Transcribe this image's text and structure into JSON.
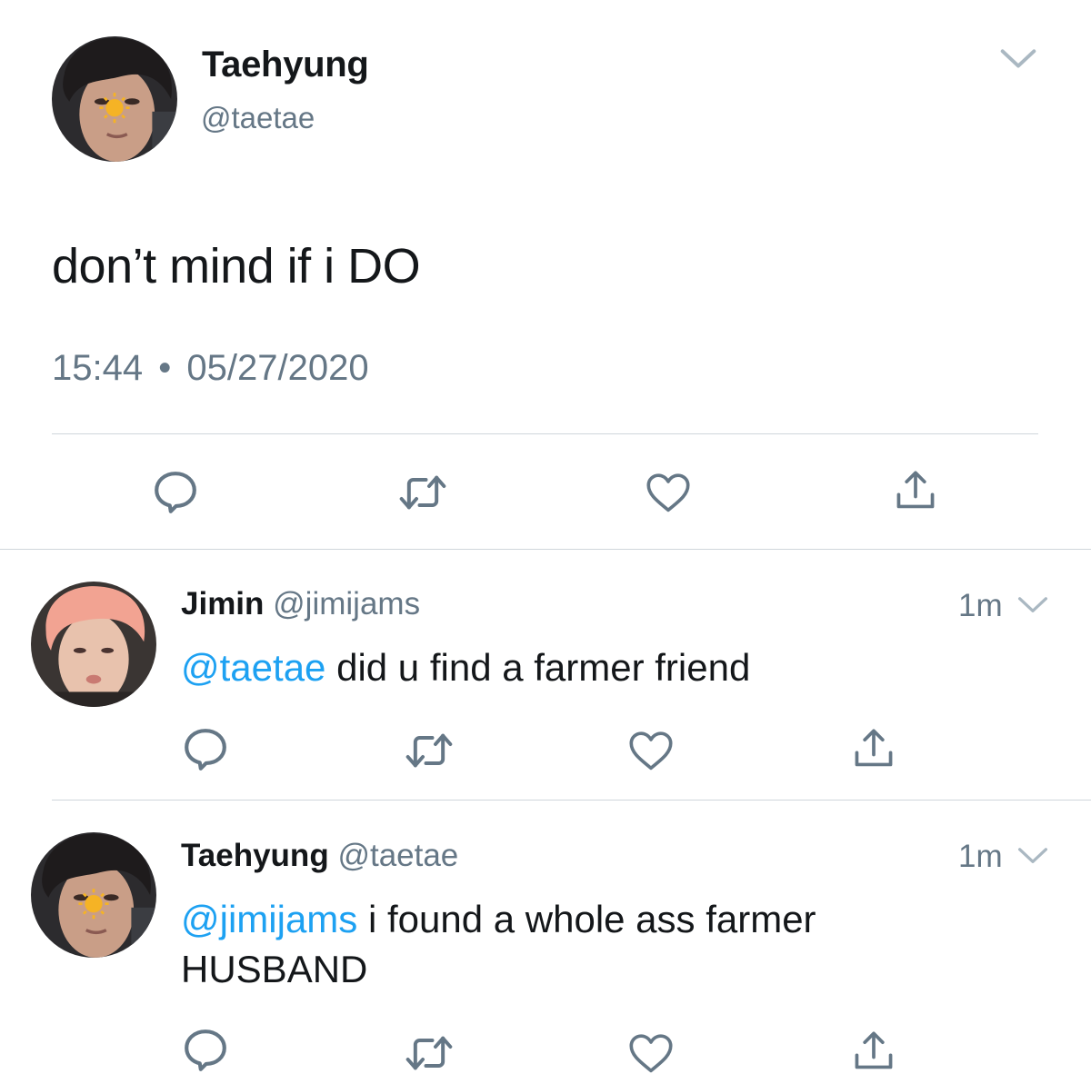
{
  "main_tweet": {
    "name": "Taehyung",
    "handle": "@taetae",
    "text": "don’t mind if i DO",
    "time": "15:44",
    "separator": "•",
    "date": "05/27/2020"
  },
  "replies": [
    {
      "name": "Jimin",
      "handle": "@jimijams",
      "time": "1m",
      "mention": "@taetae",
      "text": " did u find a farmer friend"
    },
    {
      "name": "Taehyung",
      "handle": "@taetae",
      "time": "1m",
      "mention": "@jimijams",
      "text": " i found a whole ass farmer",
      "text_line2": "HUSBAND"
    }
  ],
  "icons": [
    "chevron-down-icon",
    "reply-icon",
    "retweet-icon",
    "like-icon",
    "share-icon"
  ],
  "colors": {
    "text": "#14171a",
    "secondary": "#657786",
    "mention": "#1da1f2",
    "icon": "#657786",
    "divider": "#cfd6db"
  }
}
